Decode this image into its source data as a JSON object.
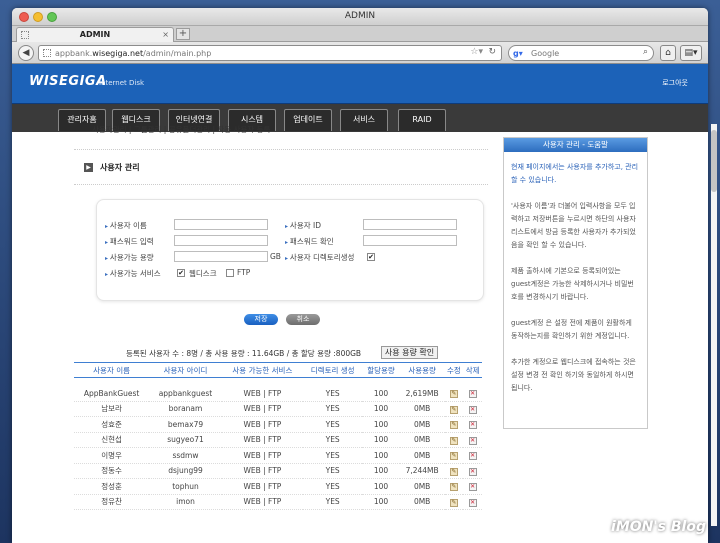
{
  "window": {
    "title": "ADMIN"
  },
  "tab": {
    "title": "ADMIN",
    "close": "×",
    "new_tab": "+"
  },
  "address": {
    "prefix": "appbank.",
    "domain": "wisegiga.net",
    "path": "/admin/main.php"
  },
  "search": {
    "engine_icon": "g-icon",
    "placeholder": "Google"
  },
  "site": {
    "logo": "WISEGIGA",
    "logo_sub": "Internet Disk",
    "logout": "로그아웃",
    "menu": [
      "관리자홈",
      "웹디스크",
      "인터넷연결",
      "시스템",
      "업데이트",
      "서비스",
      "RAID"
    ],
    "submenu": "사용자관리 | 그룹관리 | 공유폴더관리 | 자동 사용자 등록"
  },
  "section": {
    "title": "사용자 관리"
  },
  "form": {
    "user_name_label": "사용자 이름",
    "user_id_label": "사용자 ID",
    "password_label": "패스워드 입력",
    "password_confirm_label": "패스워드 확인",
    "quota_label": "사용가능 용량",
    "quota_unit": "GB",
    "create_dir_label": "사용자 디렉토리생성",
    "create_dir_checked": true,
    "services_label": "사용가능 서비스",
    "webdisk_label": "웹디스크",
    "webdisk_checked": true,
    "ftp_label": "FTP",
    "ftp_checked": false,
    "save": "저장",
    "cancel": "취소"
  },
  "summary": {
    "text": "등록된 사용자 수 : 8명 / 총 사용 용량 : 11.64GB / 총 할당 용량 :800GB",
    "check_button": "사용 용량 확인"
  },
  "table": {
    "headers": [
      "사용자 이름",
      "사용자 아이디",
      "사용 가능한 서비스",
      "디렉토리 생성",
      "할당용량",
      "사용용량",
      "수정",
      "삭제"
    ],
    "rows": [
      [
        "AppBankGuest",
        "appbankguest",
        "WEB | FTP",
        "YES",
        "100",
        "2,619MB"
      ],
      [
        "남보라",
        "boranam",
        "WEB | FTP",
        "YES",
        "100",
        "0MB"
      ],
      [
        "성효준",
        "bemax79",
        "WEB | FTP",
        "YES",
        "100",
        "0MB"
      ],
      [
        "신현섭",
        "sugyeo71",
        "WEB | FTP",
        "YES",
        "100",
        "0MB"
      ],
      [
        "이명우",
        "ssdmw",
        "WEB | FTP",
        "YES",
        "100",
        "0MB"
      ],
      [
        "정동수",
        "dsjung99",
        "WEB | FTP",
        "YES",
        "100",
        "7,244MB"
      ],
      [
        "정성훈",
        "tophun",
        "WEB | FTP",
        "YES",
        "100",
        "0MB"
      ],
      [
        "정유찬",
        "imon",
        "WEB | FTP",
        "YES",
        "100",
        "0MB"
      ]
    ]
  },
  "help": {
    "title": "사용자 관리 - 도움말",
    "paragraphs": [
      "현재 페이지에서는 사용자를 추가하고, 관리할 수 있습니다.",
      "'사용자 이름'과 더불어 입력사항을 모두 입력하고 저장버튼을 누르시면 하단의 사용자 리스트에서 방금 등록한 사용자가 추가되었음을 확인 할 수 있습니다.",
      "제품 출하시에 기본으로 등록되어있는 guest계정은 가능한 삭제하시거나 비밀번호를 변경하시기 바랍니다.",
      "guest계정 은 설정 전에 제품이 원활하게 동작하는지를 확인하기 위한 계정입니다.",
      "추가한 계정으로 웹디스크에 접속하는 것은 설정 변경 전 확인 하기와 동일하게 하시면 됩니다."
    ]
  },
  "watermark": "iMON's Blog",
  "colors": {
    "header": "#1c62b8",
    "menu": "#3a3a3a",
    "accent": "#2a62b8"
  }
}
